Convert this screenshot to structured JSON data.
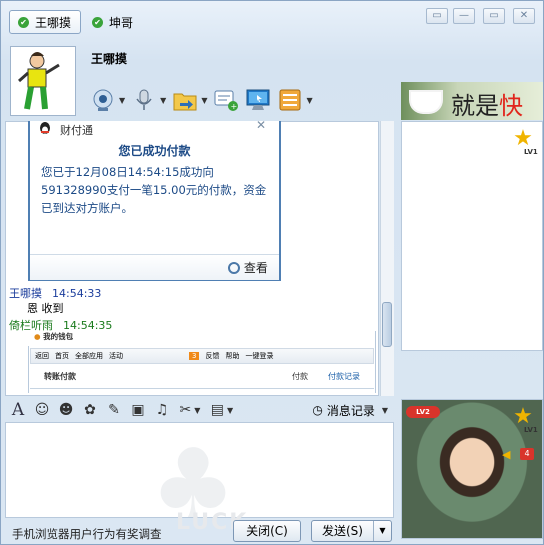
{
  "tabs": [
    {
      "label": "王哪摸",
      "active": true
    },
    {
      "label": "坤哥",
      "active": false
    }
  ],
  "window_buttons": [
    "▭",
    "—",
    "▭",
    "✕"
  ],
  "header": {
    "contact_name": "王哪摸"
  },
  "toolbar": {
    "icons": [
      "webcam-icon",
      "microphone-icon",
      "folder-transfer-icon",
      "sms-icon",
      "remote-desktop-icon",
      "apps-icon"
    ]
  },
  "banner": {
    "text_main": "就是",
    "text_accent": "快"
  },
  "side": {
    "level1": "LV1",
    "level2": "LV2",
    "badge": "4"
  },
  "payment_card": {
    "source": "财付通",
    "heading": "您已成功付款",
    "body": "您已于12月08日14:54:15成功向591328990支付一笔15.00元的付款，资金已到达对方账户。",
    "view": "查看"
  },
  "messages": [
    {
      "name": "王哪摸",
      "time": "14:54:33",
      "text": "恩 收到"
    },
    {
      "name": "倚栏听雨",
      "time": "14:54:35",
      "text": ""
    }
  ],
  "screenshot": {
    "wallet": "我的钱包",
    "nav": [
      "返回",
      "首页",
      "全部应用",
      "活动",
      "3",
      "反馈",
      "帮助",
      "一键登录"
    ],
    "page_title": "转账付款",
    "tabs": [
      "付款",
      "付款记录"
    ]
  },
  "input_toolbar": {
    "history_label": "消息记录"
  },
  "watermark": {
    "text": "LUCK"
  },
  "bottom": {
    "status": "手机浏览器用户行为有奖调查",
    "close_label": "关闭(C)",
    "send_label": "发送(S)"
  }
}
